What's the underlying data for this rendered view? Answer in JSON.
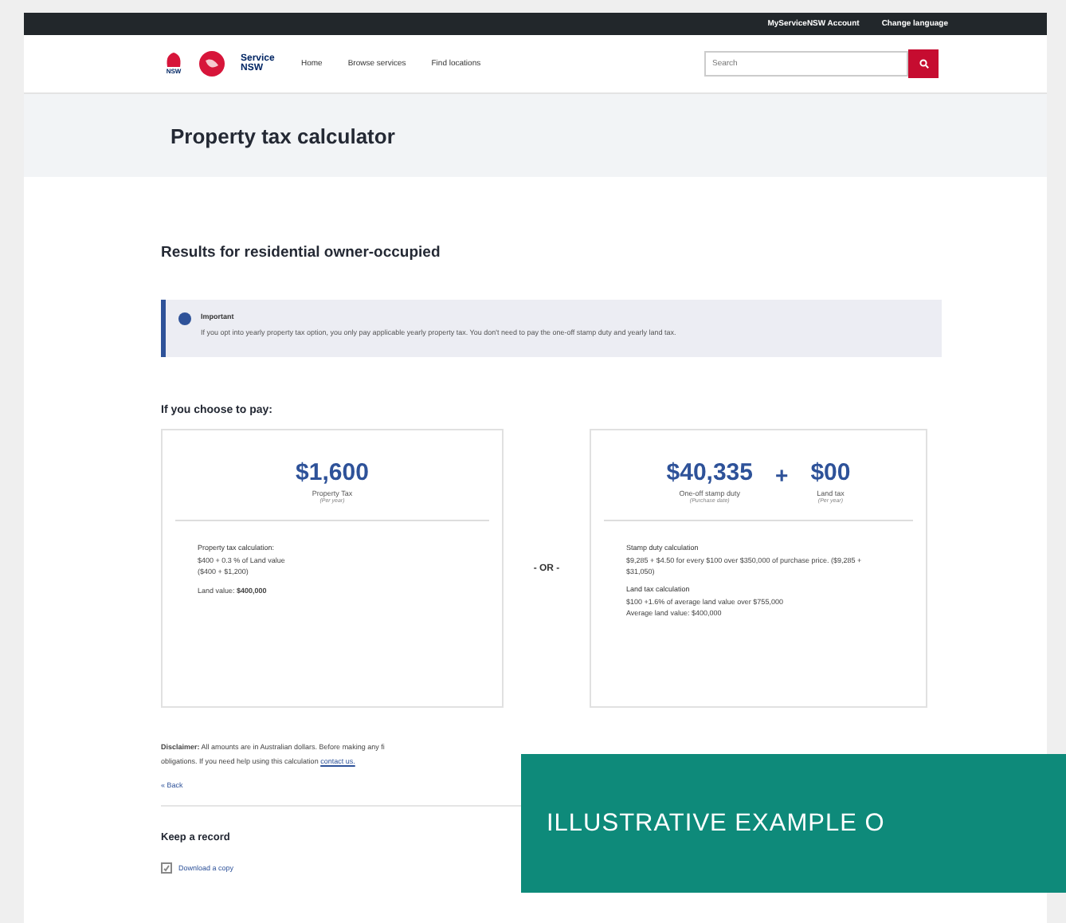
{
  "top_bar": {
    "links": [
      "MyServiceNSW Account",
      "Change language"
    ]
  },
  "header": {
    "logo_label": "NSW",
    "brand": "Service NSW",
    "nav": [
      {
        "label": "Home"
      },
      {
        "label": "Browse services"
      },
      {
        "label": "Find locations"
      }
    ],
    "search": {
      "placeholder": "Search"
    }
  },
  "page_title": "Property tax calculator",
  "results_heading": "Results for residential owner-occupied",
  "notice": {
    "title": "Important",
    "text": "If you opt into yearly property tax option, you only pay applicable yearly property tax. You don't need to pay the one-off stamp duty and yearly land tax."
  },
  "choose_heading": "If you choose to pay:",
  "options": [
    {
      "amounts": [
        {
          "value": "$1,600",
          "label": "Property Tax",
          "note": "(Per year)"
        }
      ],
      "sections": [
        {
          "title": "Property tax calculation:",
          "lines": [
            "$400 + 0.3 % of Land value",
            "($400 + $1,200)"
          ]
        },
        {
          "lines": [
            "Land value: **$400,000**"
          ]
        }
      ]
    },
    {
      "amounts": [
        {
          "value": "$40,335",
          "label": "One-off stamp duty",
          "note": "(Purchase date)"
        },
        {
          "value": "$00",
          "label": "Land tax",
          "note": "(Per year)"
        }
      ],
      "joiner": "+",
      "sections": [
        {
          "title": "Stamp duty calculation",
          "lines": [
            "$9,285 + $4.50 for every $100 over $350,000 of purchase price. ($9,285 + $31,050)"
          ]
        },
        {
          "title": "Land tax calculation",
          "lines": [
            "$100 +1.6% of average land value over $755,000",
            "Average land value: $400,000"
          ]
        }
      ]
    }
  ],
  "separator": "- OR -",
  "disclaimer": {
    "lines": [
      "**Disclaimer:** All amounts are in Australian dollars. Before making any fi",
      "obligations. If you need help using this calculation"
    ],
    "link": "contact us."
  },
  "back_link": "« Back",
  "record": {
    "heading": "Keep a record",
    "download": "Download a copy"
  },
  "overlay": "ILLUSTRATIVE EXAMPLE O"
}
